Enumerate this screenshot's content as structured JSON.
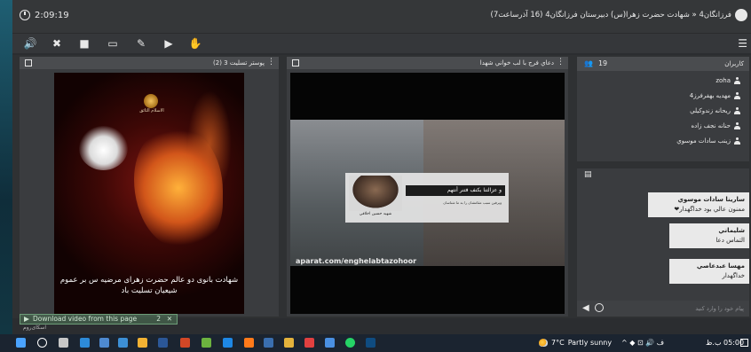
{
  "window": {
    "timer": "2:09:19",
    "room_title": "فرزانگان4 « شهادت حضرت زهرا(س) دبیرستان فرزانگان4 (16 آذرساعت7)"
  },
  "toolbar": {
    "icons": [
      "speaker-icon",
      "mute-mic-icon",
      "camera-icon",
      "screen-share-icon",
      "pen-icon",
      "play-icon",
      "hand-icon",
      "menu-icon"
    ]
  },
  "panels": {
    "poster": {
      "title": "پوستر تسليت 3 (2)"
    },
    "video": {
      "title": "دعاي فرج با لب خواني شهدا",
      "nameplate_name": "شهيد حسين اخلاقي",
      "nameplate_bar": "و عزالتنا بكنف فتنر أنتهم",
      "nameplate_sub": "ويرفين سبب مقامشان را به ما شناسان",
      "watermark": "aparat.com/enghelabtazohoor"
    },
    "poster_caption": "شهادت بانوی دو عالم حضرت زهرای مرضیه س بر عموم شیعیان تسلیت باد",
    "poster_top_text": "الاسلام الثائق"
  },
  "users": {
    "header_label": "کاربران",
    "count": "19",
    "list": [
      {
        "name": "zoha"
      },
      {
        "name": "مهديه بهفرفرز4"
      },
      {
        "name": "ريحانه زندوكيلي"
      },
      {
        "name": "حنانه نجف زاده"
      },
      {
        "name": "زينب سادات موسوي"
      }
    ]
  },
  "chat": {
    "messages": [
      {
        "name": "سارينا سادات موسوي",
        "text": "ممنون عالي بود خداگهدار❤"
      },
      {
        "name": "شليماني",
        "text": "التماس دعا"
      },
      {
        "name": "مهسا عبدعاصي",
        "text": "خداگهدار"
      }
    ],
    "input_placeholder": "پیام خود را وارد کنید"
  },
  "download_bar": {
    "label": "Download video from this page",
    "number": "2",
    "close": "✕"
  },
  "brand_small": "اسکای‌روم",
  "taskbar": {
    "weather_temp": "7°C",
    "weather_text": "Partly sunny",
    "tray": "^ ◆ ⊡ 🔊 ف",
    "time": "05:00 ب.ظ"
  }
}
